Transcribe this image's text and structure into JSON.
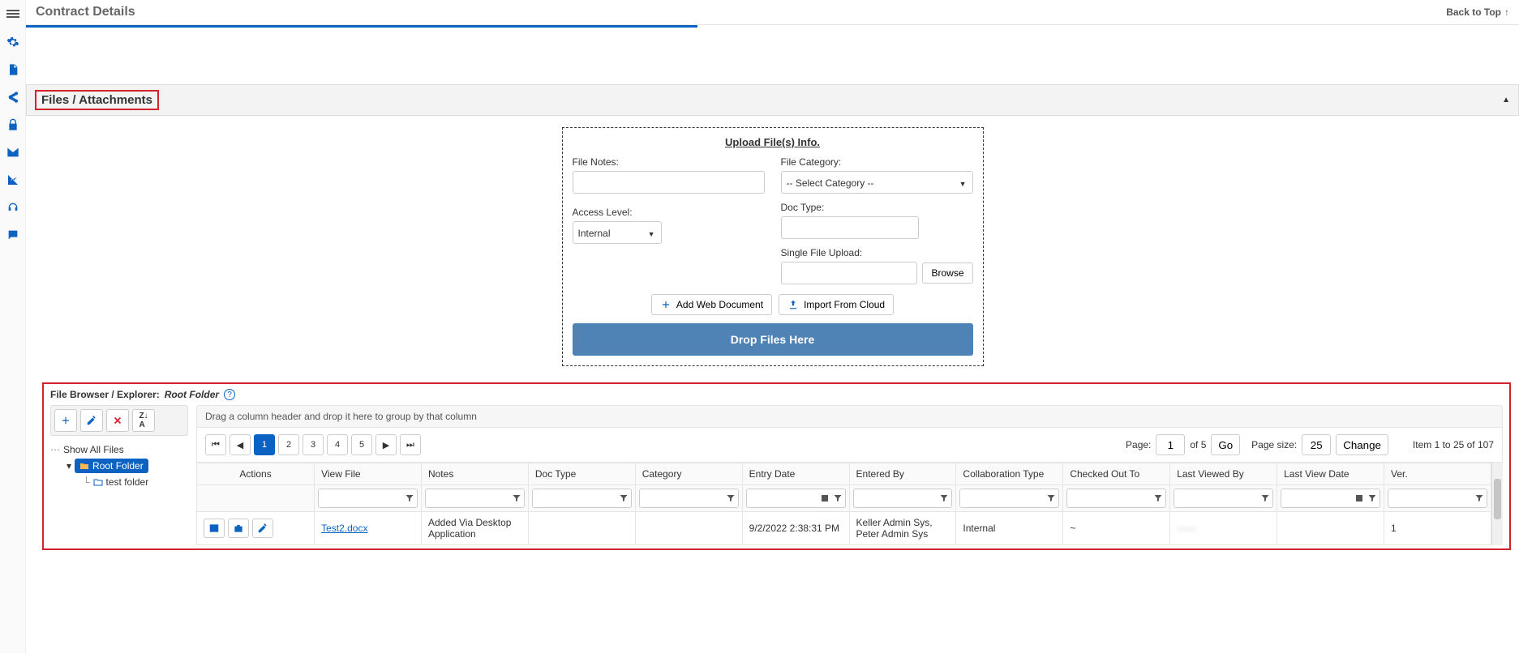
{
  "header": {
    "title": "Contract Details",
    "back_to_top": "Back to Top"
  },
  "section": {
    "files_attachments": "Files / Attachments"
  },
  "upload": {
    "title": "Upload File(s) Info.",
    "file_notes_label": "File Notes:",
    "access_level_label": "Access Level:",
    "access_level_value": "Internal",
    "file_category_label": "File Category:",
    "file_category_value": "-- Select Category --",
    "doc_type_label": "Doc Type:",
    "single_file_label": "Single File Upload:",
    "browse": "Browse",
    "add_web_doc": "Add Web Document",
    "import_cloud": "Import From Cloud",
    "drop_zone": "Drop Files Here"
  },
  "browser": {
    "label": "File Browser / Explorer:",
    "root": "Root Folder",
    "show_all": "Show All Files",
    "root_folder": "Root Folder",
    "test_folder": "test folder",
    "group_hint": "Drag a column header and drop it here to group by that column"
  },
  "pager": {
    "pages": [
      "1",
      "2",
      "3",
      "4",
      "5"
    ],
    "active": "1",
    "page_label": "Page:",
    "page_value": "1",
    "of": "of 5",
    "go": "Go",
    "size_label": "Page size:",
    "size_value": "25",
    "change": "Change",
    "summary": "Item 1 to 25 of 107"
  },
  "columns": {
    "actions": "Actions",
    "view_file": "View File",
    "notes": "Notes",
    "doc_type": "Doc Type",
    "category": "Category",
    "entry_date": "Entry Date",
    "entered_by": "Entered By",
    "collab_type": "Collaboration Type",
    "checked_out": "Checked Out To",
    "last_viewed_by": "Last Viewed By",
    "last_view_date": "Last View Date",
    "ver": "Ver."
  },
  "rows": [
    {
      "file": "Test2.docx",
      "notes": "Added Via Desktop Application",
      "doc_type": "",
      "category": "",
      "entry_date": "9/2/2022 2:38:31 PM",
      "entered_by": "Keller Admin Sys, Peter Admin Sys",
      "collab_type": "Internal",
      "checked_out": "~",
      "last_viewed_by": "——",
      "last_view_date": "",
      "ver": "1"
    }
  ]
}
